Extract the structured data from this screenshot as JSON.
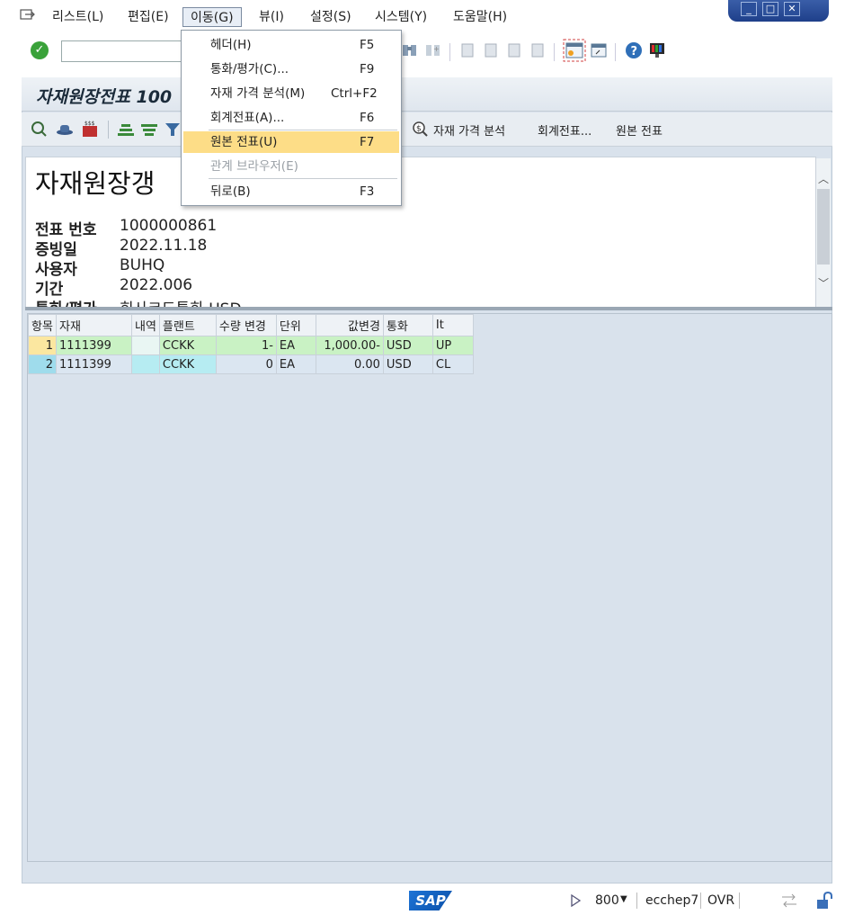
{
  "menu": {
    "items": [
      {
        "label": "리스트(L)",
        "active": false
      },
      {
        "label": "편집(E)",
        "active": false
      },
      {
        "label": "이동(G)",
        "active": true
      },
      {
        "label": "뷰(I)",
        "active": false
      },
      {
        "label": "설정(S)",
        "active": false
      },
      {
        "label": "시스템(Y)",
        "active": false
      },
      {
        "label": "도움말(H)",
        "active": false
      }
    ]
  },
  "toolbar": {
    "command_value": "",
    "icons": [
      "check-icon",
      "command-field",
      "binoculars-icon",
      "find-next-icon",
      "first-page-icon",
      "prev-page-icon",
      "next-page-icon",
      "last-page-icon",
      "new-session-icon",
      "shortcut-icon",
      "help-icon",
      "layout-icon"
    ]
  },
  "title": {
    "text": "자재원장전표 100"
  },
  "app_toolbar": {
    "price_analysis": "자재 가격 분석",
    "accounting_doc": "회계전표...",
    "original_doc": "원본 전표"
  },
  "header": {
    "doc_title": "자재원장갱",
    "fields": [
      {
        "label": "전표 번호",
        "value": "1000000861"
      },
      {
        "label": "증빙일",
        "value": "2022.11.18"
      },
      {
        "label": "사용자",
        "value": "BUHQ"
      },
      {
        "label": "기간",
        "value": "2022.006"
      },
      {
        "label": "통화/평가",
        "value": "회사코드통화 USD"
      }
    ]
  },
  "table": {
    "columns": [
      "항목",
      "자재",
      "내역",
      "플랜트",
      "수량 변경",
      "단위",
      "값변경",
      "통화",
      "It"
    ],
    "rows": [
      [
        "1",
        "1111399",
        "",
        "CCKK",
        "1-",
        "EA",
        "1,000.00-",
        "USD",
        "UP"
      ],
      [
        "2",
        "1111399",
        "",
        "CCKK",
        "0",
        "EA",
        "0.00",
        "USD",
        "CL"
      ]
    ]
  },
  "dropdown": {
    "items": [
      {
        "label": "헤더(H)",
        "shortcut": "F5",
        "highlight": false,
        "disabled": false
      },
      {
        "label": "통화/평가(C)...",
        "shortcut": "F9",
        "highlight": false,
        "disabled": false
      },
      {
        "label": "자재 가격 분석(M)",
        "shortcut": "Ctrl+F2",
        "highlight": false,
        "disabled": false
      },
      {
        "label": "회계전표(A)...",
        "shortcut": "F6",
        "highlight": false,
        "disabled": false
      },
      {
        "label": "원본 전표(U)",
        "shortcut": "F7",
        "highlight": true,
        "disabled": false
      },
      {
        "label": "관계 브라우저(E)",
        "shortcut": "",
        "highlight": false,
        "disabled": true
      },
      {
        "label": "뒤로(B)",
        "shortcut": "F3",
        "highlight": false,
        "disabled": false
      }
    ]
  },
  "status": {
    "client": "800",
    "server": "ecchep7",
    "mode": "OVR"
  }
}
